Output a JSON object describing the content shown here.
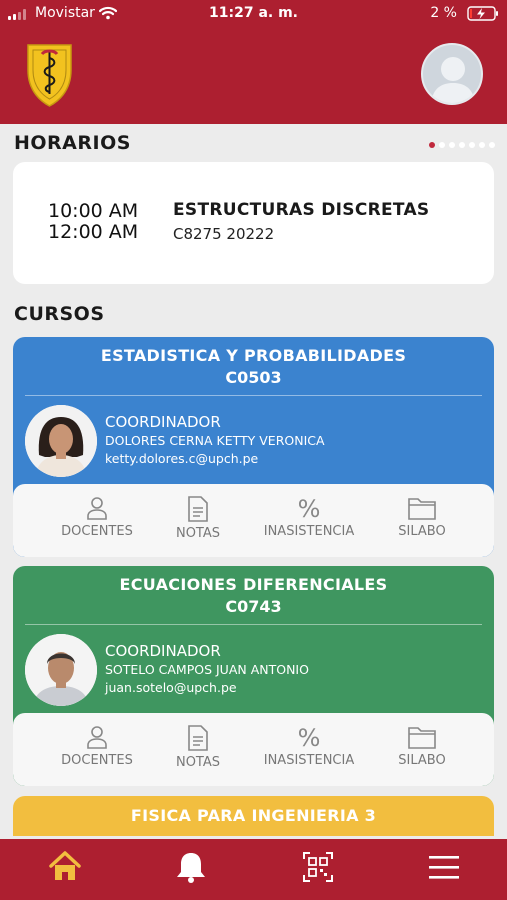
{
  "status_bar": {
    "carrier": "Movistar",
    "time": "11:27 a. m.",
    "battery": "2 %"
  },
  "colors": {
    "brand_red": "#ad1f30",
    "course_blue": "#3b83cf",
    "course_green": "#3f9660",
    "course_yellow": "#f2be3f",
    "home_active": "#f2be3f"
  },
  "schedule": {
    "title": "HORARIOS",
    "start": "10:00 AM",
    "end": "12:00 AM",
    "course": "ESTRUCTURAS DISCRETAS",
    "code": "C8275 20222"
  },
  "courses": {
    "title": "CURSOS",
    "items": [
      {
        "name": "ESTADISTICA Y PROBABILIDADES",
        "code": "C0503",
        "role": "COORDINADOR",
        "coordinator": "DOLORES CERNA KETTY VERONICA",
        "email": "ketty.dolores.c@upch.pe"
      },
      {
        "name": "ECUACIONES DIFERENCIALES",
        "code": "C0743",
        "role": "COORDINADOR",
        "coordinator": "SOTELO CAMPOS JUAN ANTONIO",
        "email": "juan.sotelo@upch.pe"
      },
      {
        "name": "FISICA PARA INGENIERIA 3"
      }
    ],
    "actions": {
      "docentes": "DOCENTES",
      "notas": "NOTAS",
      "inasistencia": "INASISTENCIA",
      "silabo": "SILABO",
      "percent_symbol": "%"
    }
  },
  "icons": {
    "nav": [
      "home-icon",
      "bell-icon",
      "qr-code-icon",
      "menu-icon"
    ]
  }
}
